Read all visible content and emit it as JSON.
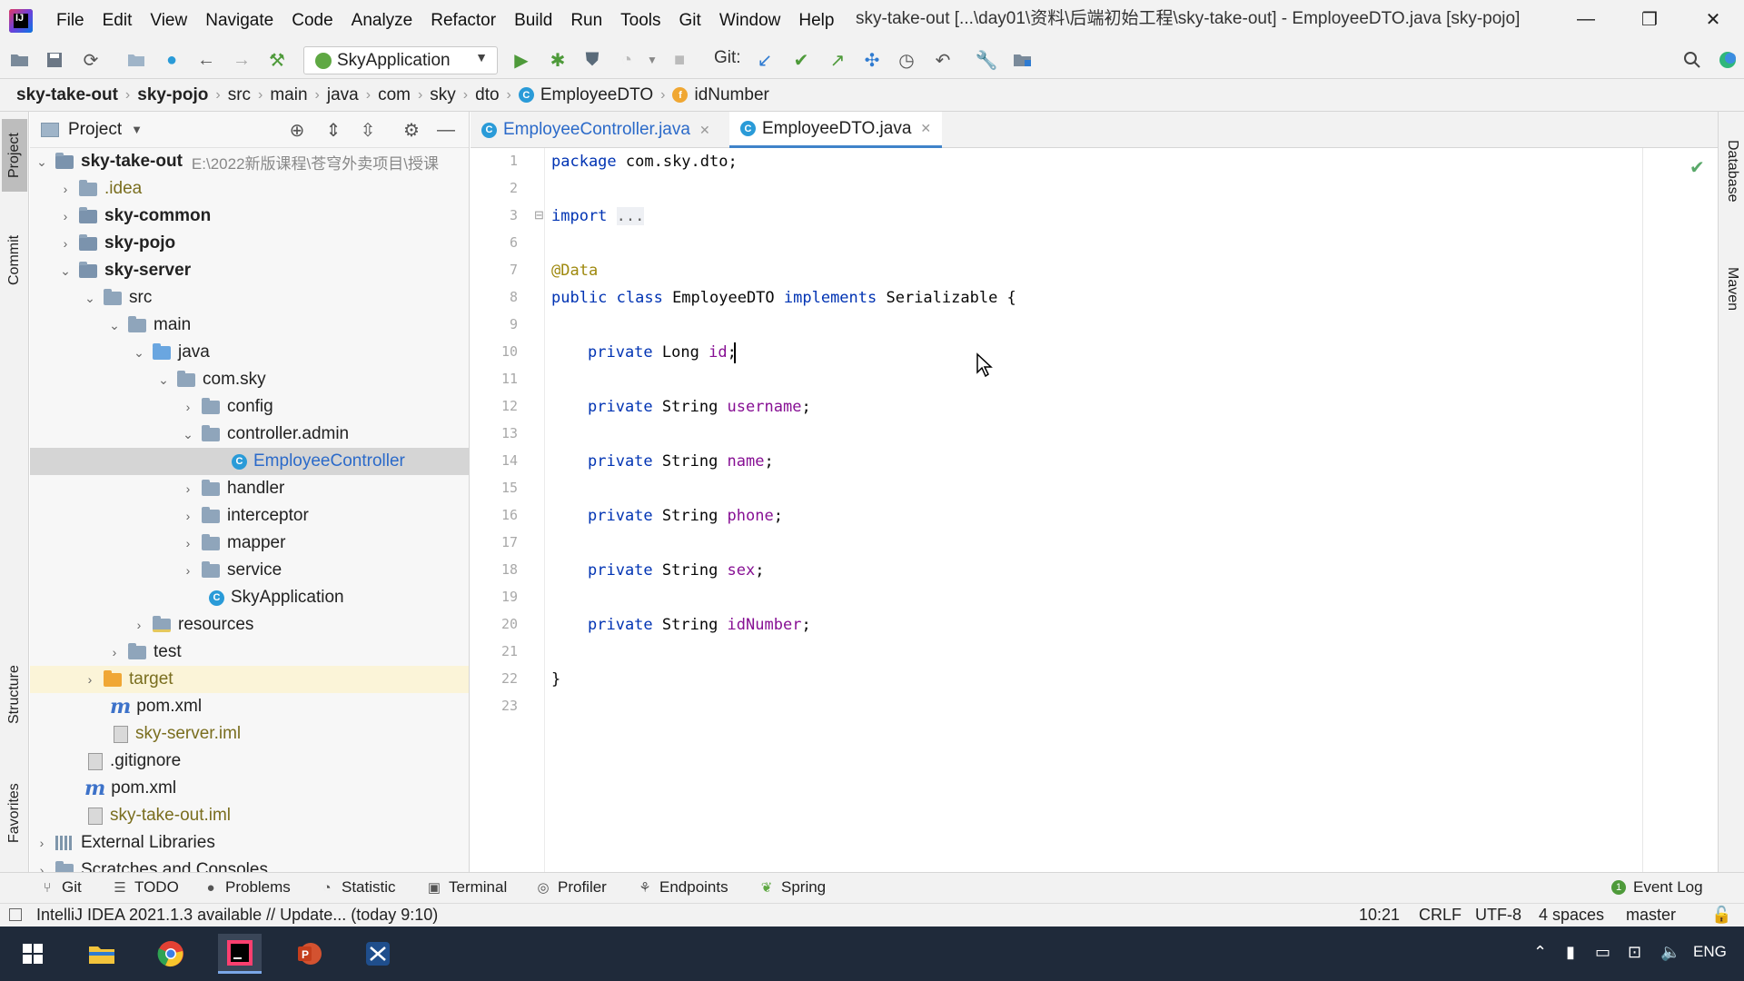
{
  "titlebar": {
    "logo_text": "IJ",
    "menu": [
      "File",
      "Edit",
      "View",
      "Navigate",
      "Code",
      "Analyze",
      "Refactor",
      "Build",
      "Run",
      "Tools",
      "Git",
      "Window",
      "Help"
    ],
    "window_title": "sky-take-out [...\\day01\\资料\\后端初始工程\\sky-take-out] - EmployeeDTO.java [sky-pojo]",
    "minimize": "—",
    "restore": "❐",
    "close": "✕"
  },
  "toolbar": {
    "run_config": "SkyApplication",
    "git_label": "Git:"
  },
  "breadcrumbs": {
    "items": [
      "sky-take-out",
      "sky-pojo",
      "src",
      "main",
      "java",
      "com",
      "sky",
      "dto",
      "EmployeeDTO",
      "idNumber"
    ],
    "class_badge": "C",
    "field_badge": "f"
  },
  "left_strip": {
    "project": "Project",
    "commit": "Commit",
    "structure": "Structure",
    "favorites": "Favorites"
  },
  "right_strip": {
    "database": "Database",
    "maven": "Maven"
  },
  "project_panel": {
    "title": "Project",
    "root_path": "E:\\2022新版课程\\苍穹外卖项目\\授课",
    "tree": {
      "root": "sky-take-out",
      "idea": ".idea",
      "sky_common": "sky-common",
      "sky_pojo": "sky-pojo",
      "sky_server": "sky-server",
      "src": "src",
      "main": "main",
      "java": "java",
      "com_sky": "com.sky",
      "config": "config",
      "controller_admin": "controller.admin",
      "employee_controller": "EmployeeController",
      "handler": "handler",
      "interceptor": "interceptor",
      "mapper": "mapper",
      "service": "service",
      "sky_application": "SkyApplication",
      "resources": "resources",
      "test": "test",
      "target": "target",
      "pom_server": "pom.xml",
      "server_iml": "sky-server.iml",
      "gitignore": ".gitignore",
      "pom_root": "pom.xml",
      "root_iml": "sky-take-out.iml",
      "external_libraries": "External Libraries",
      "scratches": "Scratches and Consoles"
    }
  },
  "editor": {
    "tabs": [
      {
        "label": "EmployeeController.java",
        "badge": "C",
        "close": "✕"
      },
      {
        "label": "EmployeeDTO.java",
        "badge": "C",
        "close": "✕"
      }
    ],
    "line_numbers": [
      "1",
      "2",
      "3",
      "6",
      "7",
      "8",
      "9",
      "10",
      "11",
      "12",
      "13",
      "14",
      "15",
      "16",
      "17",
      "18",
      "19",
      "20",
      "21",
      "22",
      "23"
    ],
    "code": {
      "l1_kw": "package",
      "l1_rest": " com.sky.dto;",
      "l3_kw": "import",
      "l3_fold": "...",
      "l7": "@Data",
      "l8_kw1": "public class",
      "l8_name": " EmployeeDTO ",
      "l8_kw2": "implements",
      "l8_rest": " Serializable {",
      "priv": "private",
      "l10_type": " Long ",
      "l10_field": "id",
      "semi": ";",
      "str": " String ",
      "l12_field": "username",
      "l14_field": "name",
      "l16_field": "phone",
      "l18_field": "sex",
      "l20_field": "idNumber",
      "l22": "}"
    }
  },
  "tool_tabs": [
    "Git",
    "TODO",
    "Problems",
    "Statistic",
    "Terminal",
    "Profiler",
    "Endpoints",
    "Spring",
    "Event Log"
  ],
  "status_bar": {
    "message": "IntelliJ IDEA 2021.1.3 available // Update... (today 9:10)",
    "position": "10:21",
    "line_sep": "CRLF",
    "encoding": "UTF-8",
    "indent": "4 spaces",
    "branch": "master"
  },
  "taskbar": {
    "lang": "ENG"
  },
  "colors": {
    "accent": "#4083c9",
    "keyword": "#0033b3",
    "field": "#871094",
    "annotation": "#9e880d"
  }
}
